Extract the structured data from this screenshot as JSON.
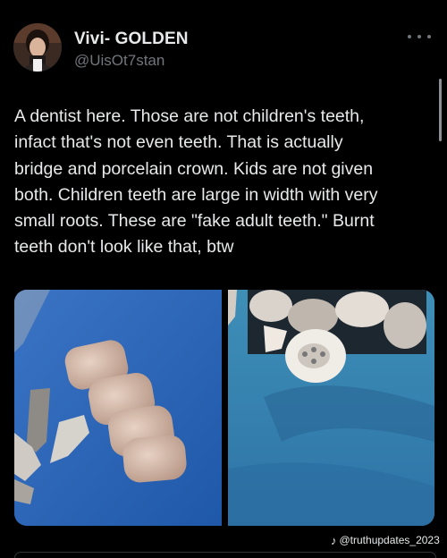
{
  "author": {
    "display_name": "Vivi- GOLDEN",
    "handle": "@UisOt7stan",
    "avatar_icon": "user-avatar-photo"
  },
  "tweet": {
    "text_lines": [
      "A dentist here. Those are not children's teeth,",
      "infact that's not even teeth. That is actually",
      "bridge and porcelain crown. Kids are not given",
      "both. Children teeth are large in width with very",
      "small roots. These are \"fake adult teeth.\" Burnt",
      "teeth don't look like that, btw"
    ]
  },
  "media": {
    "watermark": "@truthupdates_2023",
    "watermark_icon": "tiktok-icon"
  },
  "colors": {
    "background": "#000000",
    "text_primary": "#e7e9ea",
    "text_secondary": "#71767b",
    "divider": "#2f3336"
  }
}
